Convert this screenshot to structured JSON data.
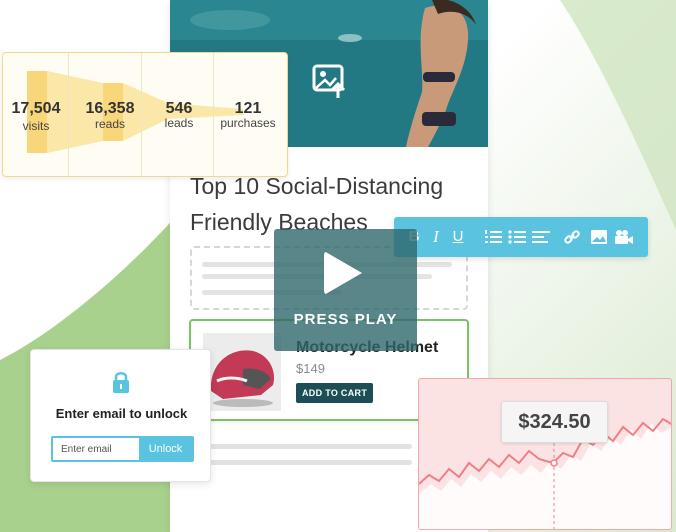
{
  "article": {
    "title_line1": "Top 10 Social-Distancing",
    "title_line2": "Friendly Beaches"
  },
  "funnel": {
    "steps": [
      {
        "value": "17,504",
        "label": "visits"
      },
      {
        "value": "16,358",
        "label": "reads"
      },
      {
        "value": "546",
        "label": "leads"
      },
      {
        "value": "121",
        "label": "purchases"
      }
    ],
    "color": "#f8d77a"
  },
  "toolbar": {
    "items": [
      "bold-icon",
      "italic-icon",
      "underline-icon",
      "ordered-list-icon",
      "bullet-list-icon",
      "align-left-icon",
      "link-icon",
      "image-icon",
      "video-icon"
    ],
    "bold": "B",
    "italic": "I",
    "underline": "U",
    "color": "#5ac3e0"
  },
  "play": {
    "label": "PRESS PLAY"
  },
  "product": {
    "name": "Motorcycle Helmet",
    "price": "$149",
    "button": "ADD TO CART"
  },
  "unlock": {
    "title": "Enter email to unlock",
    "placeholder": "Enter email",
    "button": "Unlock"
  },
  "price_chart": {
    "value": "$324.50"
  },
  "colors": {
    "green_accent": "#7cc26a",
    "teal_dark": "#1c4f55",
    "pink": "#f2a7ab"
  }
}
